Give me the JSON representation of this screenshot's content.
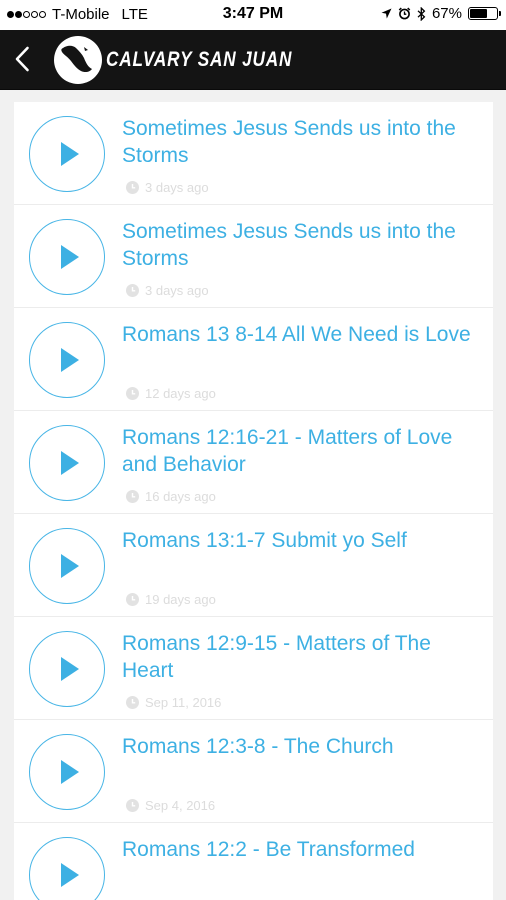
{
  "status_bar": {
    "carrier": "T-Mobile",
    "network": "LTE",
    "time": "3:47 PM",
    "battery": "67%",
    "battery_level": 0.67
  },
  "nav": {
    "title": "CALVARY SAN JUAN"
  },
  "colors": {
    "accent": "#3db0e3",
    "nav_bg": "#141414",
    "meta_gray": "#dcdcdc"
  },
  "sermons": [
    {
      "title": "Sometimes Jesus Sends us into the Storms",
      "date": "3 days ago"
    },
    {
      "title": "Sometimes Jesus Sends us into the Storms",
      "date": "3 days ago"
    },
    {
      "title": "Romans 13 8-14 All We Need is Love",
      "date": "12 days ago"
    },
    {
      "title": "Romans 12:16-21 - Matters of Love and Behavior",
      "date": "16 days ago"
    },
    {
      "title": "Romans 13:1-7 Submit yo Self",
      "date": "19 days ago"
    },
    {
      "title": "Romans 12:9-15 - Matters of The Heart",
      "date": "Sep 11, 2016"
    },
    {
      "title": "Romans 12:3-8 - The Church",
      "date": "Sep 4, 2016"
    },
    {
      "title": "Romans 12:2 - Be Transformed",
      "date": ""
    }
  ]
}
